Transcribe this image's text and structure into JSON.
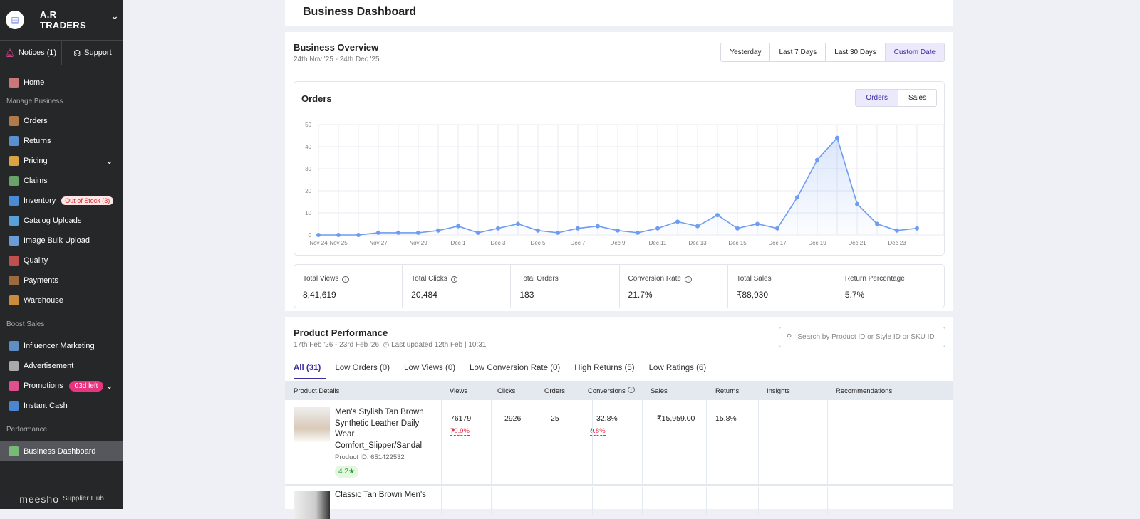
{
  "sidebar": {
    "company": "A.R TRADERS",
    "notices": "Notices (1)",
    "support": "Support",
    "home": "Home",
    "sec_manage": "Manage Business",
    "items": [
      {
        "label": "Orders",
        "color": "#b07a4a"
      },
      {
        "label": "Returns",
        "color": "#5a8fd0"
      },
      {
        "label": "Pricing",
        "color": "#d9a441"
      },
      {
        "label": "Claims",
        "color": "#6aa36a"
      },
      {
        "label": "Inventory",
        "color": "#4a8bd6",
        "badge": "Out of Stock (3)"
      },
      {
        "label": "Catalog Uploads",
        "color": "#5aa0d8"
      },
      {
        "label": "Image Bulk Upload",
        "color": "#6c9bd8"
      },
      {
        "label": "Quality",
        "color": "#c0504d"
      },
      {
        "label": "Payments",
        "color": "#9b6a3e"
      },
      {
        "label": "Warehouse",
        "color": "#c98b3c"
      }
    ],
    "sec_boost": "Boost Sales",
    "boost": [
      {
        "label": "Influencer Marketing",
        "color": "#5f8ec7"
      },
      {
        "label": "Advertisement",
        "color": "#aaaaaa"
      },
      {
        "label": "Promotions",
        "color": "#e0508f",
        "badge": "03d left"
      },
      {
        "label": "Instant Cash",
        "color": "#4b86d1"
      }
    ],
    "sec_perf": "Performance",
    "active": "Business Dashboard",
    "footer_logo": "meesho",
    "footer_text": "Supplier Hub"
  },
  "header": {
    "title": "Business Dashboard"
  },
  "overview": {
    "title": "Business Overview",
    "range": "24th Nov '25 - 24th Dec '25",
    "filters": [
      "Yesterday",
      "Last 7 Days",
      "Last 30 Days",
      "Custom Date"
    ],
    "selected_filter": "Custom Date",
    "chart_title": "Orders",
    "toggles": [
      "Orders",
      "Sales"
    ],
    "selected_toggle": "Orders",
    "stats": [
      {
        "label": "Total Views",
        "value": "8,41,619",
        "info": true
      },
      {
        "label": "Total Clicks",
        "value": "20,484",
        "info": true
      },
      {
        "label": "Total Orders",
        "value": "183"
      },
      {
        "label": "Conversion Rate",
        "value": "21.7%",
        "info": true
      },
      {
        "label": "Total Sales",
        "value": "₹88,930"
      },
      {
        "label": "Return Percentage",
        "value": "5.7%"
      }
    ]
  },
  "chart_data": {
    "type": "area",
    "ylim": [
      0,
      50
    ],
    "yticks": [
      "0",
      "10",
      "20",
      "30",
      "40",
      "50"
    ],
    "grid": true,
    "line_color": "#6e9cf0",
    "x": [
      "Nov 24",
      "Nov 25",
      "Nov 26",
      "Nov 27",
      "Nov 28",
      "Nov 29",
      "Nov 30",
      "Dec 1",
      "Dec 2",
      "Dec 3",
      "Dec 4",
      "Dec 5",
      "Dec 6",
      "Dec 7",
      "Dec 8",
      "Dec 9",
      "Dec 10",
      "Dec 11",
      "Dec 12",
      "Dec 13",
      "Dec 14",
      "Dec 15",
      "Dec 16",
      "Dec 17",
      "Dec 18",
      "Dec 19",
      "Dec 20",
      "Dec 21",
      "Dec 22",
      "Dec 23",
      "Dec 24"
    ],
    "xtick_labels": [
      "Nov 24",
      "Nov 25",
      "",
      "Nov 27",
      "",
      "Nov 29",
      "",
      "Dec 1",
      "",
      "Dec 3",
      "",
      "Dec 5",
      "",
      "Dec 7",
      "",
      "Dec 9",
      "",
      "Dec 11",
      "",
      "Dec 13",
      "",
      "Dec 15",
      "",
      "Dec 17",
      "",
      "Dec 19",
      "",
      "Dec 21",
      "",
      "Dec 23",
      ""
    ],
    "values": [
      0,
      0,
      0,
      1,
      1,
      1,
      2,
      4,
      1,
      3,
      5,
      2,
      1,
      3,
      4,
      2,
      1,
      3,
      6,
      4,
      9,
      3,
      5,
      3,
      17,
      34,
      44,
      14,
      5,
      2,
      3
    ]
  },
  "products": {
    "title": "Product Performance",
    "range": "17th Feb '26 - 23rd Feb '26",
    "updated": "Last updated 12th Feb | 10:31",
    "search_placeholder": "Search by Product ID or Style ID or SKU ID",
    "tabs": [
      "All (31)",
      "Low Orders (0)",
      "Low Views (0)",
      "Low Conversion Rate (0)",
      "High Returns (5)",
      "Low Ratings (6)"
    ],
    "columns": [
      "Product Details",
      "Views",
      "Clicks",
      "Orders",
      "Conversions",
      "Sales",
      "Returns",
      "Insights",
      "Recommendations"
    ],
    "rows": [
      {
        "name": "Men's Stylish Tan Brown Synthetic Leather Daily Wear Comfort_Slipper/Sandal",
        "id": "Product ID: 651422532",
        "rating": "4.2★",
        "views": "76179",
        "views_change": "70.9%",
        "clicks": "2926",
        "orders": "25",
        "conversions": "32.8%",
        "conv_change": "8.8%",
        "sales": "₹15,959.00",
        "returns": "15.8%"
      },
      {
        "name": "Classic Tan Brown Men's"
      }
    ]
  }
}
